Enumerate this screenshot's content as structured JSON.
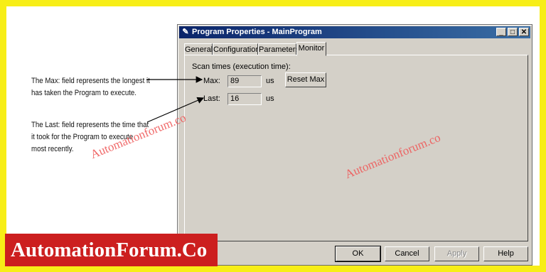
{
  "annotations": {
    "max_note_line1": "The Max: field represents the longest it",
    "max_note_line2": "has taken the Program to execute.",
    "last_note_line1": "The Last: field represents the time that",
    "last_note_line2": "it took for the Program to execute",
    "last_note_line3": "most recently."
  },
  "dialog": {
    "title": "Program Properties - MainProgram",
    "title_icon": "program-properties-icon",
    "window_buttons": [
      "minimize",
      "maximize",
      "close"
    ],
    "tabs": [
      {
        "label": "General",
        "active": false
      },
      {
        "label": "Configuration",
        "active": false
      },
      {
        "label": "Parameters",
        "active": false
      },
      {
        "label": "Monitor",
        "active": true
      }
    ],
    "monitor": {
      "group_label": "Scan times (execution time):",
      "max_label": "Max:",
      "max_value": "89",
      "max_unit": "us",
      "last_label": "Last:",
      "last_value": "16",
      "last_unit": "us",
      "reset_max_label": "Reset Max"
    },
    "buttons": {
      "ok": "OK",
      "cancel": "Cancel",
      "apply": "Apply",
      "help": "Help"
    }
  },
  "watermarks": [
    "Automationforum.co",
    "Automationforum.co"
  ],
  "brand": "AutomationForum.Co",
  "colors": {
    "frame": "#f7ee17",
    "titlebar_start": "#0a246a",
    "titlebar_end": "#3a6ea5",
    "dialog_face": "#d4d0c8",
    "watermark": "#ef5a5a",
    "brand_bg": "#cc1f1f"
  }
}
